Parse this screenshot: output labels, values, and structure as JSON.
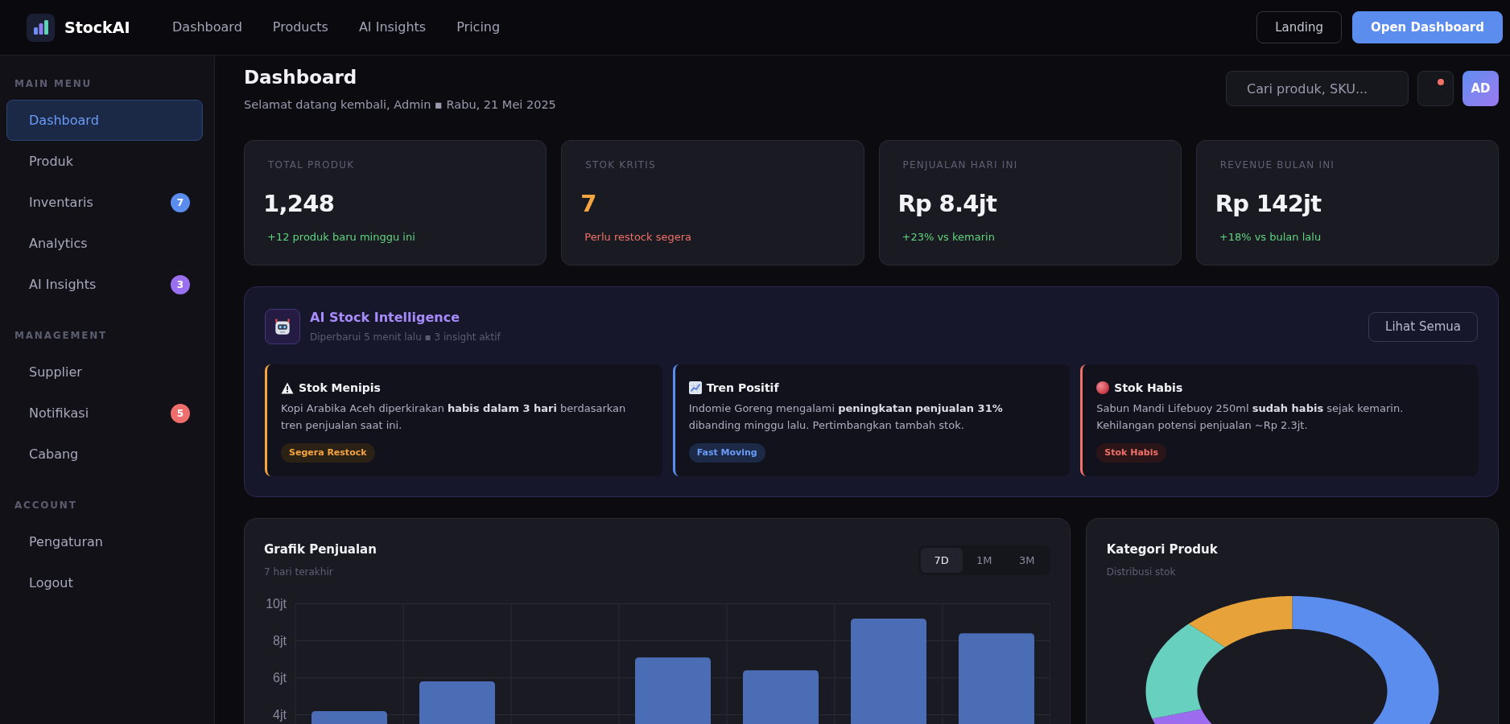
{
  "nav": {
    "brand": "StockAI",
    "links": [
      "Dashboard",
      "Products",
      "AI Insights",
      "Pricing"
    ],
    "buttons": [
      {
        "label": "Landing",
        "kind": "outline"
      },
      {
        "label": "Open Dashboard",
        "kind": "primary"
      }
    ]
  },
  "sidebar": {
    "sections": [
      {
        "title": "MAIN MENU",
        "items": [
          {
            "label": "Dashboard",
            "selected": true
          },
          {
            "label": "Produk",
            "selected": false
          },
          {
            "label": "Inventaris",
            "selected": false,
            "badge": "7",
            "color": "#5b8def"
          },
          {
            "label": "Analytics",
            "selected": false
          },
          {
            "label": "AI Insights",
            "selected": false,
            "badge": "3",
            "color": "#9b70f0"
          }
        ]
      },
      {
        "title": "MANAGEMENT",
        "items": [
          {
            "label": "Supplier",
            "selected": false
          },
          {
            "label": "Notifikasi",
            "selected": false,
            "badge": "5",
            "color": "#ee6e6e"
          },
          {
            "label": "Cabang",
            "selected": false
          }
        ]
      },
      {
        "title": "ACCOUNT",
        "items": [
          {
            "label": "Pengaturan",
            "selected": false
          },
          {
            "label": "Logout",
            "selected": false
          }
        ]
      }
    ]
  },
  "header": {
    "title": "Dashboard",
    "subtitle": "Selamat datang kembali, Admin ▪ Rabu, 21 Mei 2025",
    "search": {
      "placeholder": "Cari produk, SKU..."
    },
    "notifications": {
      "unread": true
    },
    "avatar": "AD"
  },
  "stats": [
    {
      "label": "TOTAL PRODUK",
      "value": "1,248",
      "note": "+12 produk baru minggu ini",
      "kind": "normal"
    },
    {
      "label": "STOK KRITIS",
      "value": "7",
      "note": "Perlu restock segera",
      "kind": "alert"
    },
    {
      "label": "PENJUALAN HARI INI",
      "value": "Rp 8.4jt",
      "note": "+23% vs kemarin",
      "kind": "normal"
    },
    {
      "label": "REVENUE BULAN INI",
      "value": "Rp 142jt",
      "note": "+18% vs bulan lalu",
      "kind": "normal"
    }
  ],
  "ai_panel": {
    "title": "AI Stock Intelligence",
    "subtitle": "Diperbarui 5 menit lalu ▪ 3 insight aktif",
    "button": "Lihat Semua",
    "insights": [
      {
        "kind": "warning",
        "title": "Stok Menipis",
        "text": "Kopi Arabika Aceh diperkirakan **habis dalam 3 hari** berdasarkan tren penjualan saat ini.",
        "tag": "Segera Restock"
      },
      {
        "kind": "positive",
        "title": "Tren Positif",
        "text": "Indomie Goreng mengalami **peningkatan penjualan 31%** dibanding minggu lalu. Pertimbangkan tambah stok.",
        "tag": "Fast Moving"
      },
      {
        "kind": "danger",
        "title": "Stok Habis",
        "text": "Sabun Mandi Lifebuoy 250ml **sudah habis** sejak kemarin. Kehilangan potensi penjualan ~Rp 2.3jt.",
        "tag": "Stok Habis"
      }
    ]
  },
  "sales_chart": {
    "title": "Grafik Penjualan",
    "subtitle": "7 hari terakhir",
    "ranges": [
      {
        "label": "7D",
        "selected": true
      },
      {
        "label": "1M",
        "selected": false
      },
      {
        "label": "3M",
        "selected": false
      }
    ],
    "chart_data": {
      "type": "bar",
      "values": [
        4.2,
        5.8,
        null,
        7.1,
        6.4,
        9.2,
        8.4
      ],
      "ylim": [
        3.5,
        10
      ],
      "yticks": [
        {
          "value": 4,
          "label": "4jt"
        },
        {
          "value": 6,
          "label": "6jt"
        },
        {
          "value": 8,
          "label": "8jt"
        },
        {
          "value": 10,
          "label": "10jt"
        }
      ],
      "grid": true
    }
  },
  "category_chart": {
    "title": "Kategori Produk",
    "subtitle": "Distribusi stok"
  }
}
